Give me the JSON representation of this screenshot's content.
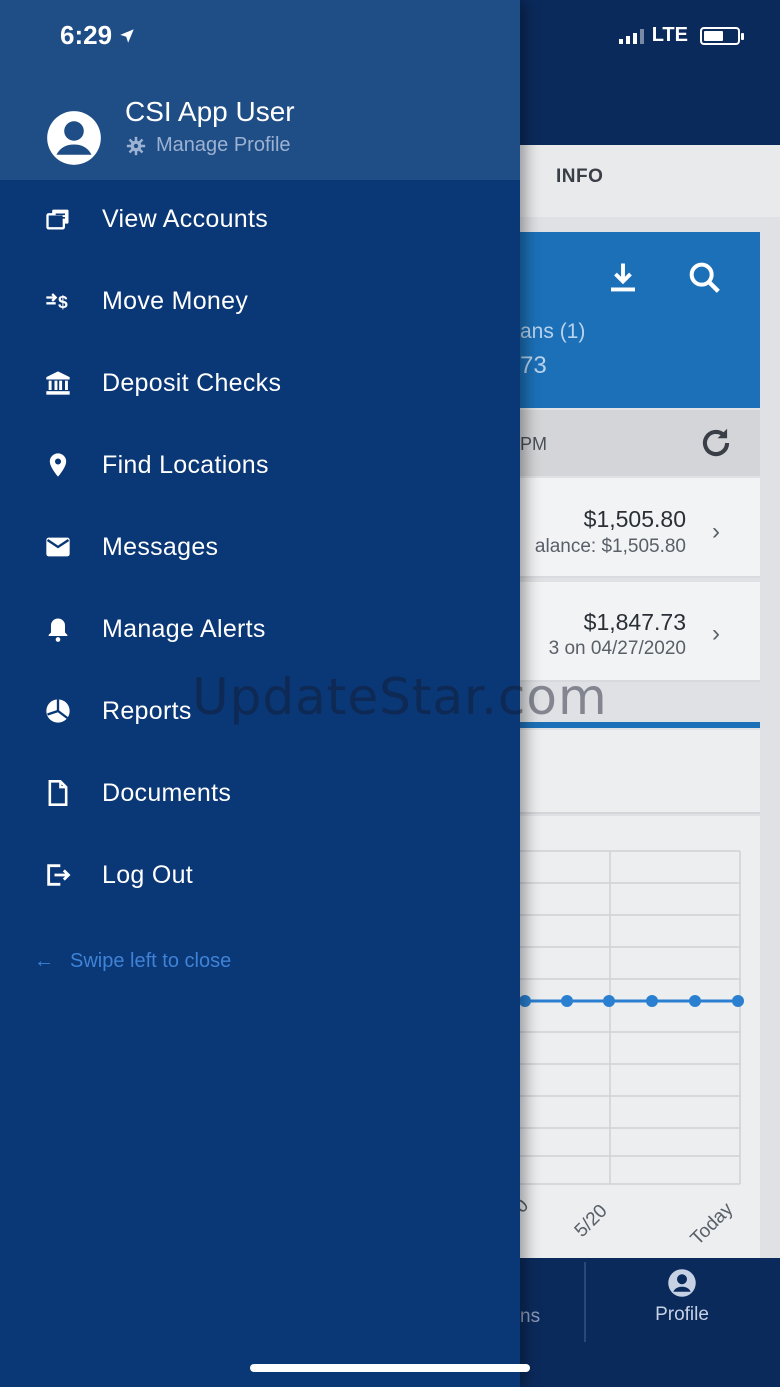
{
  "status_bar": {
    "time": "6:29",
    "network": "LTE",
    "battery_level": 0.6
  },
  "drawer": {
    "user_name": "CSI App User",
    "manage_profile_label": "Manage Profile",
    "menu_items": [
      {
        "label": "View Accounts",
        "icon": "accounts-icon"
      },
      {
        "label": "Move Money",
        "icon": "transfer-icon"
      },
      {
        "label": "Deposit Checks",
        "icon": "bank-icon"
      },
      {
        "label": "Find Locations",
        "icon": "location-pin-icon"
      },
      {
        "label": "Messages",
        "icon": "envelope-icon"
      },
      {
        "label": "Manage Alerts",
        "icon": "bell-icon"
      },
      {
        "label": "Reports",
        "icon": "pie-chart-icon"
      },
      {
        "label": "Documents",
        "icon": "document-icon"
      },
      {
        "label": "Log Out",
        "icon": "logout-icon"
      }
    ],
    "swipe_hint": "Swipe left to close"
  },
  "background": {
    "tab_info": "INFO",
    "summary_loans": "ans (1)",
    "summary_amount": "73",
    "updated_text": "PM",
    "accounts": [
      {
        "amount": "$1,505.80",
        "sub": "alance: $1,505.80"
      },
      {
        "amount": "$1,847.73",
        "sub": "3 on 04/27/2020"
      }
    ],
    "chart": {
      "x_labels": [
        "0",
        "5/20",
        "Today"
      ]
    },
    "nav_partial": "ns",
    "profile_label": "Profile"
  },
  "watermark": "UpdateStar.com"
}
